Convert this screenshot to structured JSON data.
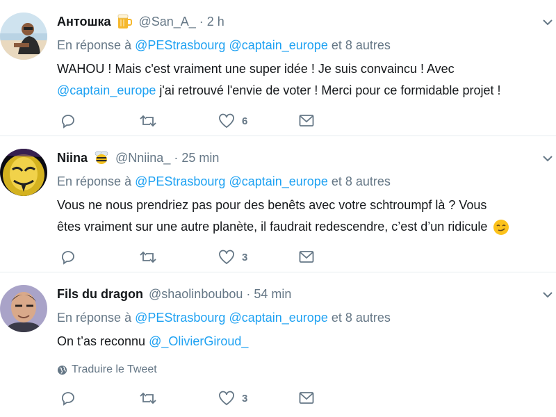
{
  "common": {
    "reply_prefix": "En réponse à",
    "reply_user1": "@PEStrasbourg",
    "reply_user2": "@captain_europe",
    "reply_suffix": "et 8 autres"
  },
  "tweets": [
    {
      "name": "Антошка",
      "handle": "@San_A_",
      "time": "2 h",
      "text_line1": "WAHOU ! Mais c'est vraiment une super idée ! Je suis convaincu ! Avec",
      "text_mention": "@captain_europe",
      "text_line2_rest": " j'ai retrouvé l'envie de voter ! Merci pour ce formidable projet !",
      "like_count": "6"
    },
    {
      "name": "Niina",
      "handle": "@Nniina_",
      "time": "25 min",
      "text_line1": "Vous ne nous prendriez pas pour des benêts avec votre schtroumpf là ? Vous",
      "text_line2": "êtes vraiment sur une autre planète, il faudrait redescendre, c’est d’un ridicule",
      "like_count": "3"
    },
    {
      "name": "Fils du dragon",
      "handle": "@shaolinboubou",
      "time": "54 min",
      "text_prefix": "On t’as reconnu ",
      "text_mention": "@_OlivierGiroud_",
      "translate": "Traduire le Tweet",
      "like_count": "3"
    }
  ],
  "colors": {
    "link": "#1da1f2",
    "muted": "#657786",
    "text": "#14171a"
  }
}
